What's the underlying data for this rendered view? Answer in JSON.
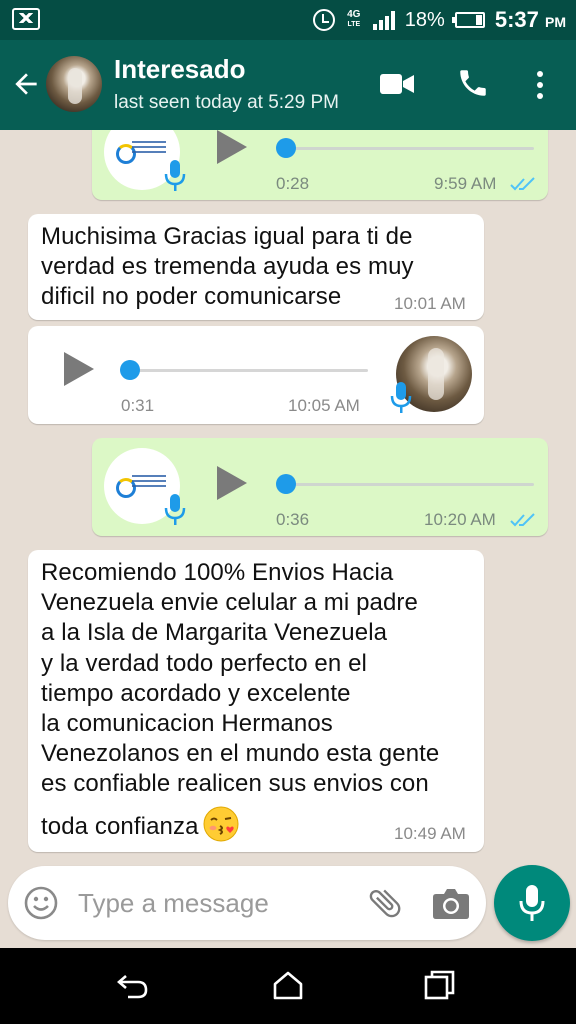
{
  "status_bar": {
    "network": "4G",
    "network_sub": "LTE",
    "battery": "18%",
    "time": "5:37",
    "ampm": "PM"
  },
  "header": {
    "contact_name": "Interesado",
    "status": "last seen today at 5:29 PM"
  },
  "messages": [
    {
      "type": "voice",
      "direction": "outgoing",
      "duration": "0:28",
      "time": "9:59 AM",
      "read": true
    },
    {
      "type": "text",
      "direction": "incoming",
      "lines": [
        "Muchisima Gracias igual para ti de",
        "verdad es tremenda ayuda es muy",
        "dificil no poder comunicarse"
      ],
      "time": "10:01 AM"
    },
    {
      "type": "voice",
      "direction": "incoming",
      "duration": "0:31",
      "time": "10:05 AM"
    },
    {
      "type": "voice",
      "direction": "outgoing",
      "duration": "0:36",
      "time": "10:20 AM",
      "read": true
    },
    {
      "type": "text",
      "direction": "incoming",
      "lines": [
        "Recomiendo 100% Envios Hacia",
        "Venezuela envie celular a mi padre",
        "a la Isla de Margarita Venezuela",
        "y la verdad todo perfecto en el",
        "tiempo acordado y excelente",
        "la comunicacion Hermanos",
        "Venezolanos en el mundo esta gente",
        "es confiable realicen sus envios con",
        "toda confianza"
      ],
      "emoji": "face-blowing-kiss",
      "time": "10:49 AM"
    }
  ],
  "composer": {
    "placeholder": "Type a message"
  },
  "colors": {
    "header": "#075e54",
    "status_bar": "#054d44",
    "outgoing_bubble": "#dcf8c6",
    "incoming_bubble": "#ffffff",
    "read_ticks": "#4fc3f7",
    "fab": "#00897b"
  },
  "icons": {
    "header": [
      "back-arrow-icon",
      "video-call-icon",
      "phone-icon",
      "more-vert-icon"
    ],
    "composer": [
      "smiley-icon",
      "attach-icon",
      "camera-icon",
      "mic-icon"
    ],
    "nav": [
      "nav-back-icon",
      "nav-home-icon",
      "nav-recents-icon"
    ]
  }
}
